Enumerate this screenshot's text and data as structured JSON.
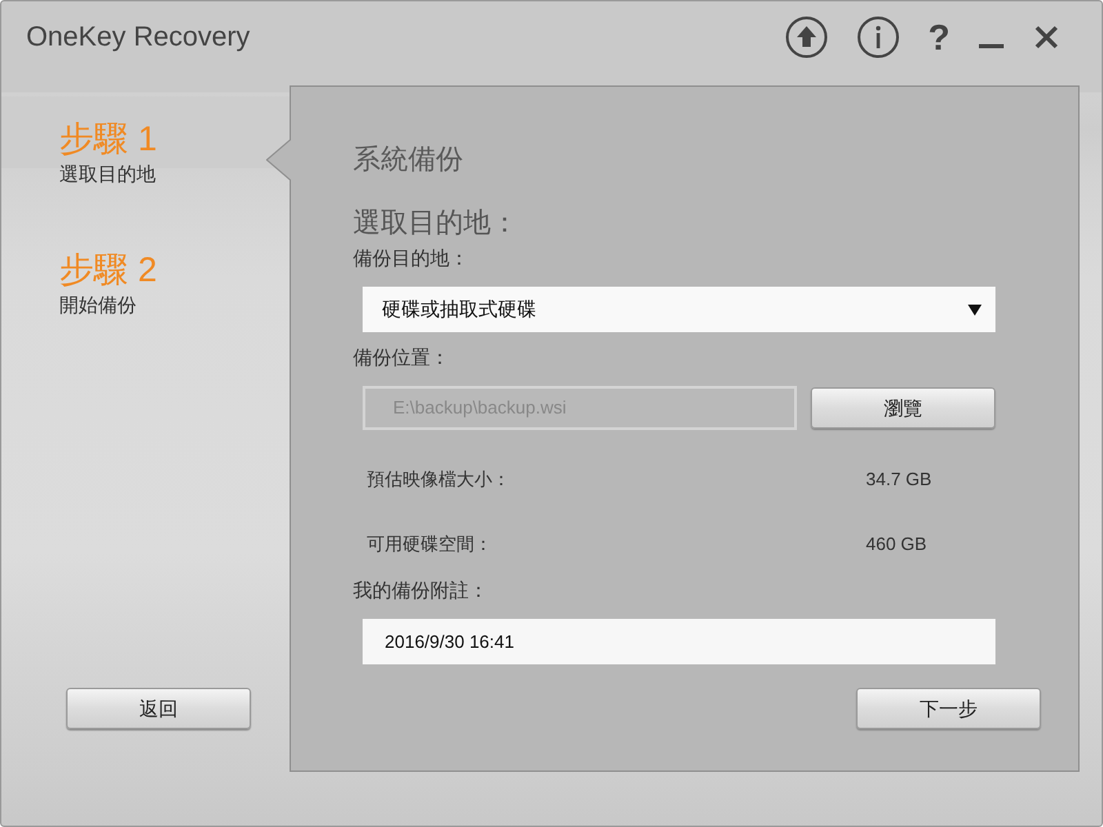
{
  "window": {
    "title": "OneKey Recovery"
  },
  "title_buttons": [
    {
      "kind": "upload"
    },
    {
      "kind": "info"
    },
    {
      "kind": "help",
      "label": "?"
    },
    {
      "kind": "minimize"
    },
    {
      "kind": "close"
    }
  ],
  "steps": [
    {
      "title": "步驟 1",
      "subtitle": "選取目的地",
      "selected": true
    },
    {
      "title": "步驟 2",
      "subtitle": "開始備份",
      "selected": false
    }
  ],
  "back_button": "返回",
  "panel": {
    "title": "系統備份",
    "heading": "選取目的地：",
    "destination": {
      "label": "備份目的地：",
      "value": "硬碟或抽取式硬碟"
    },
    "location": {
      "label": "備份位置：",
      "value": "E:\\backup\\backup.wsi",
      "disabled": true,
      "browse_button": "瀏覽"
    },
    "info_rows": [
      {
        "label": "預估映像檔大小：",
        "value": "34.7 GB"
      },
      {
        "label": "可用硬碟空間：",
        "value": "460 GB"
      }
    ],
    "note": {
      "label": "我的備份附註：",
      "value": "2016/9/30 16:41"
    },
    "next_button": "下一步"
  }
}
